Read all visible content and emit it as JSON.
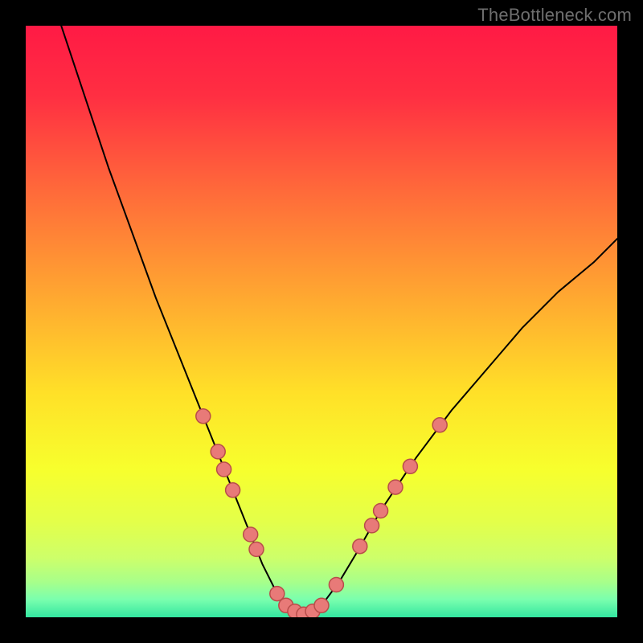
{
  "watermark": "TheBottleneck.com",
  "chart_data": {
    "type": "line",
    "title": "",
    "xlabel": "",
    "ylabel": "",
    "xlim": [
      0,
      100
    ],
    "ylim": [
      0,
      100
    ],
    "grid": false,
    "legend": false,
    "series": [
      {
        "name": "curve",
        "x": [
          6,
          10,
          14,
          18,
          22,
          26,
          30,
          34,
          36,
          38,
          40,
          42,
          44,
          46,
          48,
          50,
          53,
          56,
          60,
          66,
          72,
          78,
          84,
          90,
          96,
          100
        ],
        "y": [
          100,
          88,
          76,
          65,
          54,
          44,
          34,
          24,
          19,
          14,
          9,
          5,
          2,
          0.5,
          0.5,
          2,
          6,
          11,
          18,
          27,
          35,
          42,
          49,
          55,
          60,
          64
        ],
        "stroke": "#000000",
        "stroke_width": 2
      }
    ],
    "markers": [
      {
        "x": 30.0,
        "y": 34.0
      },
      {
        "x": 32.5,
        "y": 28.0
      },
      {
        "x": 33.5,
        "y": 25.0
      },
      {
        "x": 35.0,
        "y": 21.5
      },
      {
        "x": 38.0,
        "y": 14.0
      },
      {
        "x": 39.0,
        "y": 11.5
      },
      {
        "x": 42.5,
        "y": 4.0
      },
      {
        "x": 44.0,
        "y": 2.0
      },
      {
        "x": 45.5,
        "y": 1.0
      },
      {
        "x": 47.0,
        "y": 0.5
      },
      {
        "x": 48.5,
        "y": 1.0
      },
      {
        "x": 50.0,
        "y": 2.0
      },
      {
        "x": 52.5,
        "y": 5.5
      },
      {
        "x": 56.5,
        "y": 12.0
      },
      {
        "x": 58.5,
        "y": 15.5
      },
      {
        "x": 60.0,
        "y": 18.0
      },
      {
        "x": 62.5,
        "y": 22.0
      },
      {
        "x": 65.0,
        "y": 25.5
      },
      {
        "x": 70.0,
        "y": 32.5
      }
    ],
    "marker_style": {
      "fill": "#e87a78",
      "stroke": "#b84d4a",
      "radius": 9
    },
    "background_gradient": {
      "stops": [
        {
          "offset": 0.0,
          "color": "#ff1a45"
        },
        {
          "offset": 0.12,
          "color": "#ff2f42"
        },
        {
          "offset": 0.28,
          "color": "#ff6a3a"
        },
        {
          "offset": 0.45,
          "color": "#ffa531"
        },
        {
          "offset": 0.62,
          "color": "#ffe028"
        },
        {
          "offset": 0.75,
          "color": "#f7ff2d"
        },
        {
          "offset": 0.84,
          "color": "#e3ff4a"
        },
        {
          "offset": 0.9,
          "color": "#cdff6a"
        },
        {
          "offset": 0.94,
          "color": "#a8ff8a"
        },
        {
          "offset": 0.97,
          "color": "#7affae"
        },
        {
          "offset": 1.0,
          "color": "#33e6a0"
        }
      ]
    }
  }
}
